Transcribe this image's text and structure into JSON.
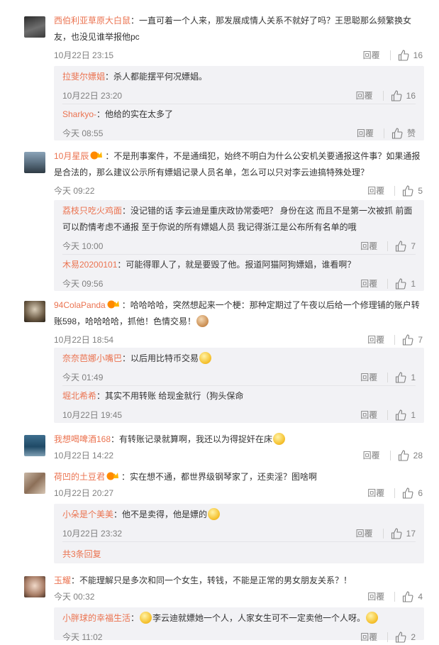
{
  "labels": {
    "reply": "回覆"
  },
  "colors": {
    "username": "#eb7350",
    "reply_bg": "#f2f2f5",
    "meta": "#808080"
  },
  "comments": [
    {
      "user": "西伯利亚草原大白鼠",
      "text": "：一直可着一个人来，那发展成情人关系不就好了吗？王思聪那么频繁换女友，也没见谁举报他pc",
      "time": "10月22日 23:15",
      "likes": "16",
      "replies": [
        {
          "user": "拉斐尔嫖娼",
          "text": "：杀人都能摆平何况嫖娼。",
          "time": "10月22日 23:20",
          "likes": "16"
        },
        {
          "user": "Sharkyo-",
          "text": "：他给的实在太多了",
          "time": "今天 08:55",
          "likes": "赞"
        }
      ]
    },
    {
      "user": "10月星辰",
      "text": "：不是刑事案件，不是通缉犯，始终不明白为什么公安机关要通报这件事？如果通报是合法的，那么建议公示所有嫖娼记录人员名单，怎么可以只对李云迪搞特殊处理？",
      "time": "今天 09:22",
      "likes": "5",
      "replies": [
        {
          "user": "荔枝只吃火鸡面",
          "text": "：没记错的话  李云迪是重庆政协常委吧？  身份在这   而且不是第一次被抓   前面可以酌情考虑不通报   至于你说的所有嫖娼人员   我记得浙江是公布所有名单的哦",
          "time": "今天 10:00",
          "likes": "7"
        },
        {
          "user": "木易20200101",
          "text": "：可能得罪人了，就是要毁了他。报道阿猫阿狗嫖娼，谁看啊？",
          "time": "今天 09:56",
          "likes": "1"
        }
      ]
    },
    {
      "user": "94ColaPanda",
      "text": "：哈哈哈哈，突然想起来一个梗：那种定期过了午夜以后给一个修理铺的账户转账598，哈哈哈哈，抓他！色情交易！",
      "time": "10月22日 18:54",
      "likes": "7",
      "replies": [
        {
          "user": "奈奈芭娜小嘴巴",
          "text": "：以后用比特币交易",
          "time": "今天 01:49",
          "likes": "1"
        },
        {
          "user": "堀北希希",
          "text": "：其实不用转账 给现金就行（狗头保命",
          "time": "10月22日 19:45",
          "likes": "1"
        }
      ]
    },
    {
      "user": "我想喝啤酒168",
      "text": "：有转账记录就算啊，我还以为得捉奸在床",
      "time": "10月22日 14:22",
      "likes": "28",
      "replies": []
    },
    {
      "user": "荷凹的土豆君",
      "text": "：实在想不通，都世界级钢琴家了，还卖淫？图啥啊",
      "time": "10月22日 20:27",
      "likes": "6",
      "replies": [
        {
          "user": "小朵是个美美",
          "text": "：他不是卖得，他是嫖的",
          "time": "10月22日 23:32",
          "likes": "17"
        }
      ],
      "more": "共3条回复"
    },
    {
      "user": "玉耀",
      "text": "：不能理解只是多次和同一个女生，转钱，不能是正常的男女朋友关系？！",
      "time": "今天 00:32",
      "likes": "4",
      "replies": [
        {
          "user": "小胖球的幸福生活",
          "text": "李云迪就嫖她一个人，人家女生可不一定卖他一个人呀。",
          "time": "今天 11:02",
          "likes": "2"
        }
      ]
    }
  ]
}
